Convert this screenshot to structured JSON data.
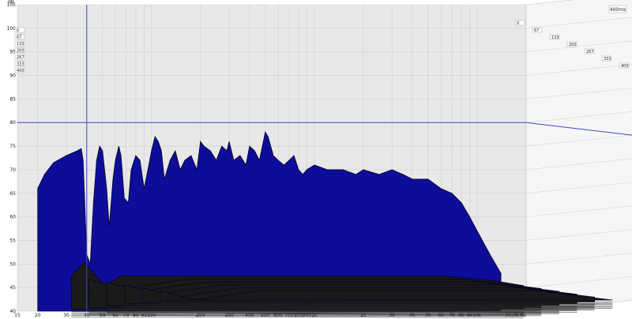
{
  "chart_data": {
    "type": "area",
    "subtype": "waterfall-3d",
    "y_unit": "dB",
    "x_unit": "Hz",
    "x_scale": "log",
    "xlim": [
      15,
      20000
    ],
    "ylim": [
      40,
      105
    ],
    "x_tick_labels": [
      "15",
      "20",
      "30",
      "40",
      "50",
      "60",
      "70",
      "80",
      "90",
      "100",
      "200",
      "300",
      "400",
      "500",
      "600",
      "700",
      "800",
      "900",
      "1k",
      "2k",
      "3k",
      "4k",
      "5k",
      "6k",
      "7k",
      "8k",
      "9k",
      "10k",
      "20,0k Hz"
    ],
    "x_tick_values": [
      15,
      20,
      30,
      40,
      50,
      60,
      70,
      80,
      90,
      100,
      200,
      300,
      400,
      500,
      600,
      700,
      800,
      900,
      1000,
      2000,
      3000,
      4000,
      5000,
      6000,
      7000,
      8000,
      9000,
      10000,
      20000
    ],
    "y_ticks": [
      40,
      45,
      50,
      55,
      60,
      65,
      70,
      75,
      80,
      85,
      90,
      95,
      100,
      105
    ],
    "time_axis_title": "400ms",
    "time_slices_ms": [
      "0",
      "67",
      "133",
      "200",
      "267",
      "333",
      "400"
    ],
    "cursor": {
      "frequency_hz": 40,
      "level_db": 80
    },
    "grid": true,
    "colors": {
      "surface": "#0d0d9a",
      "surface_edge": "#050520",
      "grid": "#cfcfcf",
      "back_wall": "#e8e8e8",
      "cursor": "#4444cc"
    },
    "series": [
      {
        "slice_ms": 0,
        "points": [
          [
            20,
            66
          ],
          [
            22,
            69
          ],
          [
            25,
            71.5
          ],
          [
            30,
            73
          ],
          [
            35,
            74
          ],
          [
            37,
            74.5
          ],
          [
            38,
            72
          ],
          [
            40,
            52
          ],
          [
            42,
            50
          ],
          [
            44,
            63
          ],
          [
            46,
            72
          ],
          [
            48,
            75
          ],
          [
            50,
            74
          ],
          [
            53,
            66
          ],
          [
            55,
            58
          ],
          [
            58,
            68
          ],
          [
            60,
            72
          ],
          [
            63,
            75
          ],
          [
            65,
            73
          ],
          [
            68,
            64
          ],
          [
            72,
            63
          ],
          [
            75,
            70
          ],
          [
            80,
            73
          ],
          [
            85,
            72
          ],
          [
            90,
            66
          ],
          [
            95,
            70
          ],
          [
            100,
            74
          ],
          [
            105,
            77
          ],
          [
            110,
            76
          ],
          [
            115,
            74
          ],
          [
            120,
            68
          ],
          [
            130,
            72
          ],
          [
            140,
            74
          ],
          [
            150,
            70
          ],
          [
            160,
            72
          ],
          [
            175,
            73
          ],
          [
            190,
            70
          ],
          [
            200,
            76
          ],
          [
            210,
            75
          ],
          [
            230,
            74
          ],
          [
            250,
            72
          ],
          [
            270,
            75
          ],
          [
            290,
            74
          ],
          [
            300,
            76
          ],
          [
            320,
            72
          ],
          [
            350,
            73
          ],
          [
            380,
            71
          ],
          [
            400,
            75
          ],
          [
            430,
            74
          ],
          [
            460,
            72
          ],
          [
            500,
            78
          ],
          [
            520,
            77
          ],
          [
            560,
            73
          ],
          [
            600,
            72
          ],
          [
            650,
            71
          ],
          [
            700,
            72
          ],
          [
            750,
            73
          ],
          [
            800,
            70
          ],
          [
            850,
            69
          ],
          [
            900,
            70
          ],
          [
            1000,
            71
          ],
          [
            1200,
            70
          ],
          [
            1500,
            70
          ],
          [
            1800,
            69
          ],
          [
            2000,
            70
          ],
          [
            2500,
            69
          ],
          [
            3000,
            70
          ],
          [
            3500,
            69
          ],
          [
            4000,
            68
          ],
          [
            5000,
            68
          ],
          [
            6000,
            66
          ],
          [
            7000,
            65
          ],
          [
            8000,
            63
          ],
          [
            9000,
            60
          ],
          [
            10000,
            57
          ],
          [
            12000,
            52
          ],
          [
            14000,
            48
          ]
        ]
      },
      {
        "slice_ms": 67,
        "points": [
          [
            25,
            47
          ],
          [
            30,
            50
          ],
          [
            40,
            45
          ],
          [
            50,
            47
          ],
          [
            100,
            47
          ],
          [
            200,
            47
          ],
          [
            500,
            47
          ],
          [
            1000,
            47
          ],
          [
            2000,
            47
          ],
          [
            5000,
            47
          ],
          [
            10000,
            46
          ],
          [
            15000,
            45
          ]
        ]
      },
      {
        "slice_ms": 133,
        "points": [
          [
            25,
            46
          ],
          [
            40,
            44
          ],
          [
            100,
            46
          ],
          [
            1000,
            46
          ],
          [
            5000,
            46
          ],
          [
            15000,
            44
          ]
        ]
      },
      {
        "slice_ms": 200,
        "points": [
          [
            25,
            45
          ],
          [
            40,
            43
          ],
          [
            100,
            45
          ],
          [
            1000,
            45
          ],
          [
            5000,
            45
          ],
          [
            15000,
            43
          ]
        ]
      },
      {
        "slice_ms": 267,
        "points": [
          [
            25,
            44
          ],
          [
            40,
            42
          ],
          [
            100,
            44
          ],
          [
            1000,
            44
          ],
          [
            5000,
            44
          ],
          [
            15000,
            42
          ]
        ]
      },
      {
        "slice_ms": 333,
        "points": [
          [
            25,
            43
          ],
          [
            40,
            41
          ],
          [
            100,
            43
          ],
          [
            1000,
            43
          ],
          [
            5000,
            43
          ],
          [
            15000,
            41
          ]
        ]
      },
      {
        "slice_ms": 400,
        "points": [
          [
            25,
            42
          ],
          [
            40,
            40
          ],
          [
            100,
            42
          ],
          [
            1000,
            42
          ],
          [
            5000,
            42
          ],
          [
            15000,
            40
          ]
        ]
      }
    ]
  }
}
